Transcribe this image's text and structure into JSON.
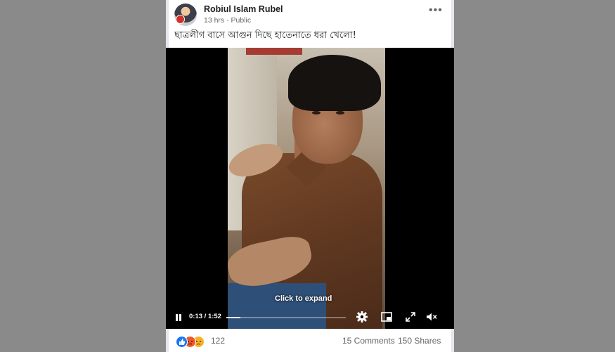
{
  "post": {
    "author": "Robiul Islam Rubel",
    "time": "13 hrs",
    "separator": "·",
    "privacy": "Public",
    "caption": "ছাত্রলীগ বাসে আগুন দিছে  হাতেনাতে ধরা খেলো!",
    "more_icon": "ellipsis-icon"
  },
  "video": {
    "overlay_text": "Click to expand",
    "current_time": "0:13",
    "time_separator": " / ",
    "duration": "1:52",
    "progress_fraction": 0.116,
    "controls": [
      "pause-icon",
      "settings-icon",
      "picture-in-picture-icon",
      "expand-icon",
      "volume-icon"
    ]
  },
  "summary": {
    "reactions": [
      "like",
      "angry",
      "sad"
    ],
    "reaction_count": "122",
    "comments": "15 Comments",
    "shares": "150 Shares"
  },
  "colors": {
    "page_background": "#8a8a8a",
    "card": "#ffffff",
    "like_blue": "#1877f2",
    "angry_orange": "#f0582a",
    "sad_yellow": "#f7b125"
  }
}
